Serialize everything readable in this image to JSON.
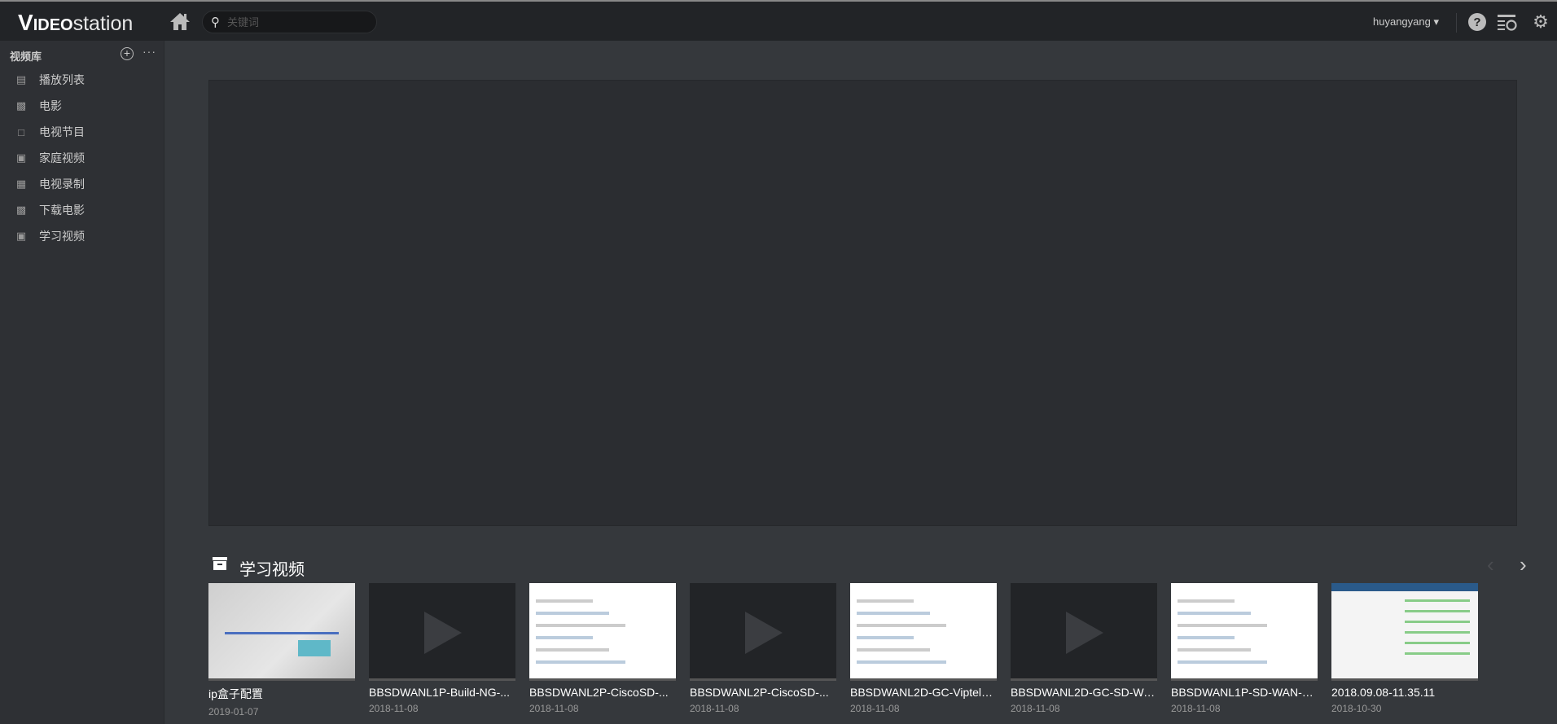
{
  "app": {
    "logo": "VIDEOstation",
    "logo_v": "V",
    "logo_ideo": "IDEO",
    "logo_station": "station"
  },
  "header": {
    "search_placeholder": "关键词",
    "username": "huyangyang ▾",
    "icons": [
      "home-icon",
      "search-icon",
      "help-icon",
      "task-queue-icon",
      "settings-icon"
    ]
  },
  "sidebar": {
    "title": "视频库",
    "items": [
      {
        "label": "播放列表",
        "icon": "playlist-icon"
      },
      {
        "label": "电影",
        "icon": "film-icon"
      },
      {
        "label": "电视节目",
        "icon": "tv-icon"
      },
      {
        "label": "家庭视频",
        "icon": "camera-icon"
      },
      {
        "label": "电视录制",
        "icon": "tv-rec-icon"
      },
      {
        "label": "下载电影",
        "icon": "film-icon"
      },
      {
        "label": "学习视频",
        "icon": "camera-icon"
      }
    ]
  },
  "section": {
    "title": "学习视频",
    "icon": "archive-icon"
  },
  "videos": [
    {
      "title": "ip盒子配置",
      "date": "2019-01-07",
      "thumb": "photo"
    },
    {
      "title": "BBSDWANL1P-Build-NG-...",
      "date": "2018-11-08",
      "thumb": "dark"
    },
    {
      "title": "BBSDWANL2P-CiscoSD-...",
      "date": "2018-11-08",
      "thumb": "slide"
    },
    {
      "title": "BBSDWANL2P-CiscoSD-...",
      "date": "2018-11-08",
      "thumb": "dark"
    },
    {
      "title": "BBSDWANL2D-GC-Viptela...",
      "date": "2018-11-08",
      "thumb": "slide"
    },
    {
      "title": "BBSDWANL2D-GC-SD-WA...",
      "date": "2018-11-08",
      "thumb": "dark"
    },
    {
      "title": "BBSDWANL1P-SD-WAN-p...",
      "date": "2018-11-08",
      "thumb": "slide"
    },
    {
      "title": "2018.09.08-11.35.11",
      "date": "2018-10-30",
      "thumb": "screen"
    }
  ]
}
